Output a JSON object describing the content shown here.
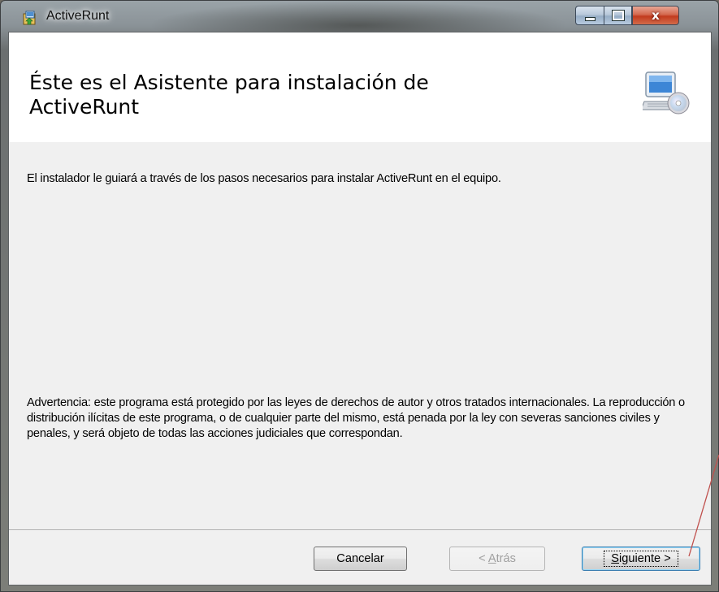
{
  "window": {
    "title": "ActiveRunt",
    "buttons": {
      "close_label": "x"
    }
  },
  "banner": {
    "heading_line1": "Éste es el Asistente para instalación de",
    "heading_line2": "ActiveRunt",
    "icon": "computer-cd-icon"
  },
  "body": {
    "intro": "El instalador le guiará a través de los pasos necesarios para instalar ActiveRunt en el equipo.",
    "warning": "Advertencia: este programa está protegido por las leyes de derechos de autor y otros tratados internacionales. La reproducción o distribución ilícitas de este programa, o de cualquier parte del mismo, está penada por la ley con severas sanciones civiles y penales, y será objeto de todas las acciones judiciales que correspondan."
  },
  "footer": {
    "cancel_label": "Cancelar",
    "back_prefix": "< ",
    "back_mnemonic": "A",
    "back_rest": "trás",
    "next_mnemonic": "S",
    "next_rest": "iguiente >"
  },
  "colors": {
    "client_bg": "#f0f0f0",
    "banner_bg": "#ffffff",
    "close_red": "#c23b1e",
    "annotation": "#c0504d"
  }
}
